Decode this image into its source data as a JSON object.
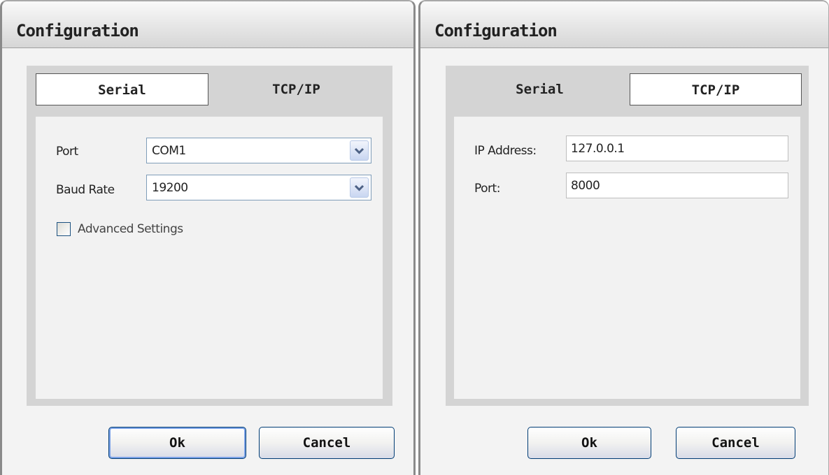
{
  "dialogs": [
    {
      "title": "Configuration",
      "tabs": [
        {
          "label": "Serial",
          "active": true
        },
        {
          "label": "TCP/IP",
          "active": false
        }
      ],
      "fields": {
        "port_label": "Port",
        "port_value": "COM1",
        "baud_label": "Baud Rate",
        "baud_value": "19200",
        "advanced_label": "Advanced Settings",
        "advanced_checked": false
      },
      "buttons": {
        "ok": "Ok",
        "cancel": "Cancel"
      }
    },
    {
      "title": "Configuration",
      "tabs": [
        {
          "label": "Serial",
          "active": false
        },
        {
          "label": "TCP/IP",
          "active": true
        }
      ],
      "fields": {
        "ip_label": "IP Address:",
        "ip_value": "127.0.0.1",
        "port_label": "Port:",
        "port_value": "8000"
      },
      "buttons": {
        "ok": "Ok",
        "cancel": "Cancel"
      }
    }
  ],
  "icons": {
    "dropdown": "chevron-down-icon"
  },
  "colors": {
    "input_border": "#7f9db9",
    "button_border": "#003c74",
    "button_focus": "#7ba2e7"
  }
}
